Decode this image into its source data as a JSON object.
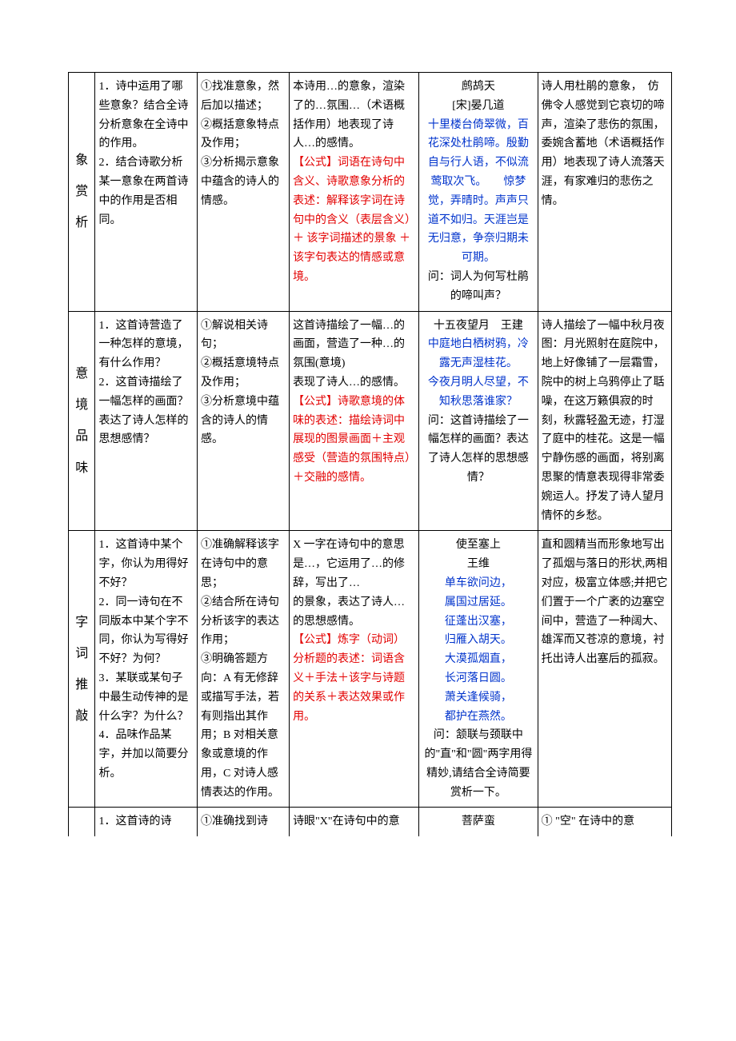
{
  "rows": [
    {
      "title": "象赏析",
      "questions": "1．诗中运用了哪些意象？结合全诗分析意象在全诗中的作用。\n2．结合诗歌分析某一意象在两首诗中的作用是否相同。",
      "methods": "①找准意象，然后加以描述；\n②概括意象特点及作用；\n③分析揭示意象中蕴含的诗人的情感。",
      "formula_pre": "本诗用…的意象，渲染了的…氛围…（术语概括作用）地表现了诗人…的感情。",
      "formula_red": "【公式】词语在诗句中含义、诗歌意象分析的表述：解释该字词在诗句中的含义（表层含义）＋ 该字词描述的景象 ＋该字句表达的情感或意境。",
      "example_title": "鹧鸪天\n[宋]晏几道",
      "example_text": "十里楼台倚翠微，百花深处杜鹃啼。殷勤自与行人语，不似流莺取次飞。　　惊梦觉，弄晴时。声声只道不如归。天涯岂是无归意，争奈归期未可期。",
      "example_question": "问：词人为何写杜鹃的啼叫声？",
      "answer": "诗人用杜鹃的意象，　仿佛令人感觉到它哀切的啼声，渲染了悲伤的氛围，委婉含蓄地（术语概括作用）地表现了诗人流落天涯，有家难归的悲伤之情。"
    },
    {
      "title": "意境品味",
      "questions": "1．这首诗营造了一种怎样的意境，有什么作用？\n2．这首诗描绘了一幅怎样的画面？表达了诗人怎样的思想感情？",
      "methods": "①解说相关诗句；\n②概括意境特点及作用；\n③分析意境中蕴含的诗人的情感。",
      "formula_pre": "这首诗描绘了一幅…的画面，营造了一种…的氛围(意境)\n表现了诗人…的感情。",
      "formula_red": "【公式】诗歌意境的体味的表述：描绘诗词中展现的图景画面＋主观感受（营造的氛围特点）＋交融的感情。",
      "example_title": "十五夜望月　王建",
      "example_text": "中庭地白栖树鸦，冷露无声湿桂花。\n今夜月明人尽望，不知秋思落谁家？",
      "example_question": "问：这首诗描绘了一幅怎样的画面？表达了诗人怎样的思想感情？",
      "answer": "诗人描绘了一幅中秋月夜图：月光照射在庭院中，地上好像铺了一层霜雪，院中的树上乌鸦停止了聒噪，在这万籁俱寂的时刻，秋露轻盈无迹，打湿了庭中的桂花。这是一幅宁静伤感的画面，将别离思聚的情意表现得非常委婉运人。抒发了诗人望月情怀的乡愁。"
    },
    {
      "title": "字词推敲",
      "questions": "1．这首诗中某个字，你认为用得好不好？\n2．同一诗句在不同版本中某个字不同，你认为写得好不好？为何？\n3．某联或某句子中最生动传神的是什么字？为什么？\n4．品味作品某字，并加以简要分析。",
      "methods": "①准确解释该字在诗句中的意思；\n②结合所在诗句分析该字的表达作用；\n③明确答题方向：A 有无修辞或描写手法，若有则指出其作用；B 对相关意象或意境的作用，C 对诗人感情表达的作用。",
      "formula_pre": "X 一字在诗句中的意思是…，它运用了…的修辞，写出了…\n的景象，表达了诗人…的思想感情。",
      "formula_red": "【公式】炼字（动词）分析题的表述：词语含义＋手法＋该字与诗题的关系＋表达效果或作用。",
      "example_title": "使至塞上\n王维",
      "example_text": "单车欲问边，\n属国过居延。\n征蓬出汉塞，\n归雁入胡天。\n大漠孤烟直，\n长河落日圆。\n萧关逢候骑，\n都护在燕然。",
      "example_question": "问：颔联与颈联中的\"直\"和\"圆\"两字用得精妙,请结合全诗简要赏析一下。",
      "answer": "直和圆精当而形象地写出了孤烟与落日的形状,两相对应，极富立体感;并把它们置于一个广袤的边塞空间中，营造了一种阔大、雄浑而又苍凉的意境，衬托出诗人出塞后的孤寂。"
    },
    {
      "title": "",
      "questions": "1．这首诗的诗",
      "methods": "①准确找到诗",
      "formula_pre": "诗眼\"X\"在诗句中的意",
      "formula_red": "",
      "example_title": "菩萨蛮",
      "example_text": "",
      "example_question": "",
      "answer": "① \"空\" 在诗中的意"
    }
  ]
}
